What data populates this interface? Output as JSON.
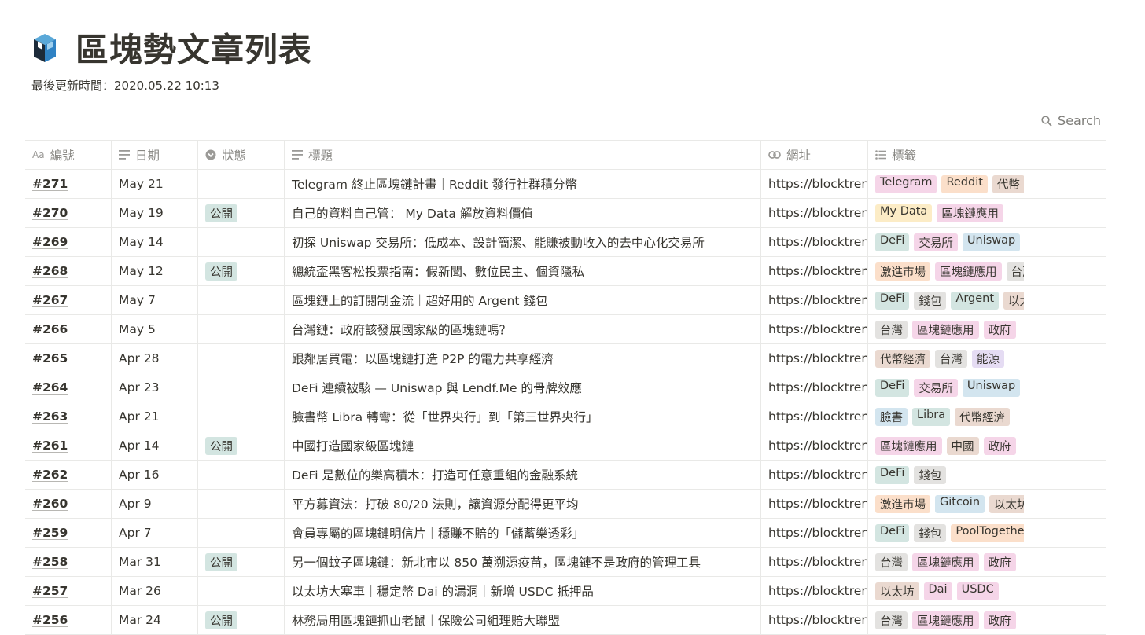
{
  "page": {
    "title": "區塊勢文章列表",
    "updated": "最後更新時間：2020.05.22 10:13",
    "search_label": "Search"
  },
  "columns": [
    {
      "label": "編號",
      "icon": "title-aa-icon"
    },
    {
      "label": "日期",
      "icon": "text-lines-icon"
    },
    {
      "label": "狀態",
      "icon": "select-chevron-icon"
    },
    {
      "label": "標題",
      "icon": "text-lines-icon"
    },
    {
      "label": "網址",
      "icon": "link-icon"
    },
    {
      "label": "標籤",
      "icon": "multi-select-list-icon"
    }
  ],
  "colors": {
    "status": "#d3e5e1",
    "tag_palette": {
      "pink": "#f5d5e8",
      "orange": "#fbdfca",
      "brown": "#ead9d0",
      "yellow": "#fcecc6",
      "green": "#d3e5e1",
      "blue": "#d3e5ef",
      "gray": "#e3e2e0",
      "purple": "#e5dcf3"
    }
  },
  "rows": [
    {
      "num": "#271",
      "date": "May 21",
      "status": "",
      "title": "Telegram 終止區塊鏈計畫｜Reddit 發行社群積分幣",
      "url": "https://blocktrend",
      "tags": [
        {
          "label": "Telegram",
          "color": "pink"
        },
        {
          "label": "Reddit",
          "color": "orange"
        },
        {
          "label": "代幣",
          "color": "brown"
        }
      ]
    },
    {
      "num": "#270",
      "date": "May 19",
      "status": "公開",
      "title": "自己的資料自己管： My Data 解放資料價值",
      "url": "https://blocktrend",
      "tags": [
        {
          "label": "My Data",
          "color": "yellow"
        },
        {
          "label": "區塊鏈應用",
          "color": "pink"
        }
      ]
    },
    {
      "num": "#269",
      "date": "May 14",
      "status": "",
      "title": "初探 Uniswap 交易所：低成本、設計簡潔、能賺被動收入的去中心化交易所",
      "url": "https://blocktrend",
      "tags": [
        {
          "label": "DeFi",
          "color": "green"
        },
        {
          "label": "交易所",
          "color": "pink"
        },
        {
          "label": "Uniswap",
          "color": "blue"
        }
      ]
    },
    {
      "num": "#268",
      "date": "May 12",
      "status": "公開",
      "title": "總統盃黑客松投票指南：假新聞、數位民主、個資隱私",
      "url": "https://blocktrend",
      "tags": [
        {
          "label": "激進市場",
          "color": "orange"
        },
        {
          "label": "區塊鏈應用",
          "color": "pink"
        },
        {
          "label": "台灣",
          "color": "gray"
        }
      ]
    },
    {
      "num": "#267",
      "date": "May 7",
      "status": "",
      "title": "區塊鏈上的訂閱制金流｜超好用的 Argent 錢包",
      "url": "https://blocktrend",
      "tags": [
        {
          "label": "DeFi",
          "color": "green"
        },
        {
          "label": "錢包",
          "color": "gray"
        },
        {
          "label": "Argent",
          "color": "green"
        },
        {
          "label": "以太坊",
          "color": "brown"
        }
      ]
    },
    {
      "num": "#266",
      "date": "May 5",
      "status": "",
      "title": "台灣鏈：政府該發展國家級的區塊鏈嗎？",
      "url": "https://blocktrend",
      "tags": [
        {
          "label": "台灣",
          "color": "gray"
        },
        {
          "label": "區塊鏈應用",
          "color": "pink"
        },
        {
          "label": "政府",
          "color": "pink"
        }
      ]
    },
    {
      "num": "#265",
      "date": "Apr 28",
      "status": "",
      "title": "跟鄰居買電：以區塊鏈打造 P2P 的電力共享經濟",
      "url": "https://blocktrend",
      "tags": [
        {
          "label": "代幣經濟",
          "color": "brown"
        },
        {
          "label": "台灣",
          "color": "gray"
        },
        {
          "label": "能源",
          "color": "purple"
        }
      ]
    },
    {
      "num": "#264",
      "date": "Apr 23",
      "status": "",
      "title": "DeFi 連續被駭 — Uniswap 與 Lendf.Me 的骨牌效應",
      "url": "https://blocktrend",
      "tags": [
        {
          "label": "DeFi",
          "color": "green"
        },
        {
          "label": "交易所",
          "color": "pink"
        },
        {
          "label": "Uniswap",
          "color": "blue"
        }
      ]
    },
    {
      "num": "#263",
      "date": "Apr 21",
      "status": "",
      "title": "臉書幣 Libra 轉彎：從「世界央行」到「第三世界央行」",
      "url": "https://blocktrend",
      "tags": [
        {
          "label": "臉書",
          "color": "blue"
        },
        {
          "label": "Libra",
          "color": "green"
        },
        {
          "label": "代幣經濟",
          "color": "brown"
        }
      ]
    },
    {
      "num": "#261",
      "date": "Apr 14",
      "status": "公開",
      "title": "中國打造國家級區塊鏈",
      "url": "https://blocktrend",
      "tags": [
        {
          "label": "區塊鏈應用",
          "color": "pink"
        },
        {
          "label": "中國",
          "color": "brown"
        },
        {
          "label": "政府",
          "color": "pink"
        }
      ]
    },
    {
      "num": "#262",
      "date": "Apr 16",
      "status": "",
      "title": "DeFi 是數位的樂高積木：打造可任意重組的金融系統",
      "url": "https://blocktrend",
      "tags": [
        {
          "label": "DeFi",
          "color": "green"
        },
        {
          "label": "錢包",
          "color": "gray"
        }
      ]
    },
    {
      "num": "#260",
      "date": "Apr 9",
      "status": "",
      "title": "平方募資法：打破 80/20 法則，讓資源分配得更平均",
      "url": "https://blocktrend",
      "tags": [
        {
          "label": "激進市場",
          "color": "orange"
        },
        {
          "label": "Gitcoin",
          "color": "blue"
        },
        {
          "label": "以太坊",
          "color": "brown"
        }
      ]
    },
    {
      "num": "#259",
      "date": "Apr 7",
      "status": "",
      "title": "會員專屬的區塊鏈明信片｜穩賺不賠的「儲蓄樂透彩」",
      "url": "https://blocktrend",
      "tags": [
        {
          "label": "DeFi",
          "color": "green"
        },
        {
          "label": "錢包",
          "color": "gray"
        },
        {
          "label": "PoolTogether",
          "color": "orange"
        }
      ]
    },
    {
      "num": "#258",
      "date": "Mar 31",
      "status": "公開",
      "title": "另一個蚊子區塊鏈：新北市以 850 萬溯源疫苗，區塊鏈不是政府的管理工具",
      "url": "https://blocktrend",
      "tags": [
        {
          "label": "台灣",
          "color": "gray"
        },
        {
          "label": "區塊鏈應用",
          "color": "pink"
        },
        {
          "label": "政府",
          "color": "pink"
        }
      ]
    },
    {
      "num": "#257",
      "date": "Mar 26",
      "status": "",
      "title": "以太坊大塞車｜穩定幣 Dai 的漏洞｜新增 USDC 抵押品",
      "url": "https://blocktrend",
      "tags": [
        {
          "label": "以太坊",
          "color": "brown"
        },
        {
          "label": "Dai",
          "color": "pink"
        },
        {
          "label": "USDC",
          "color": "pink"
        }
      ]
    },
    {
      "num": "#256",
      "date": "Mar 24",
      "status": "公開",
      "title": "林務局用區塊鏈抓山老鼠｜保險公司組理賠大聯盟",
      "url": "https://blocktrend",
      "tags": [
        {
          "label": "台灣",
          "color": "gray"
        },
        {
          "label": "區塊鏈應用",
          "color": "pink"
        },
        {
          "label": "政府",
          "color": "pink"
        }
      ]
    }
  ]
}
